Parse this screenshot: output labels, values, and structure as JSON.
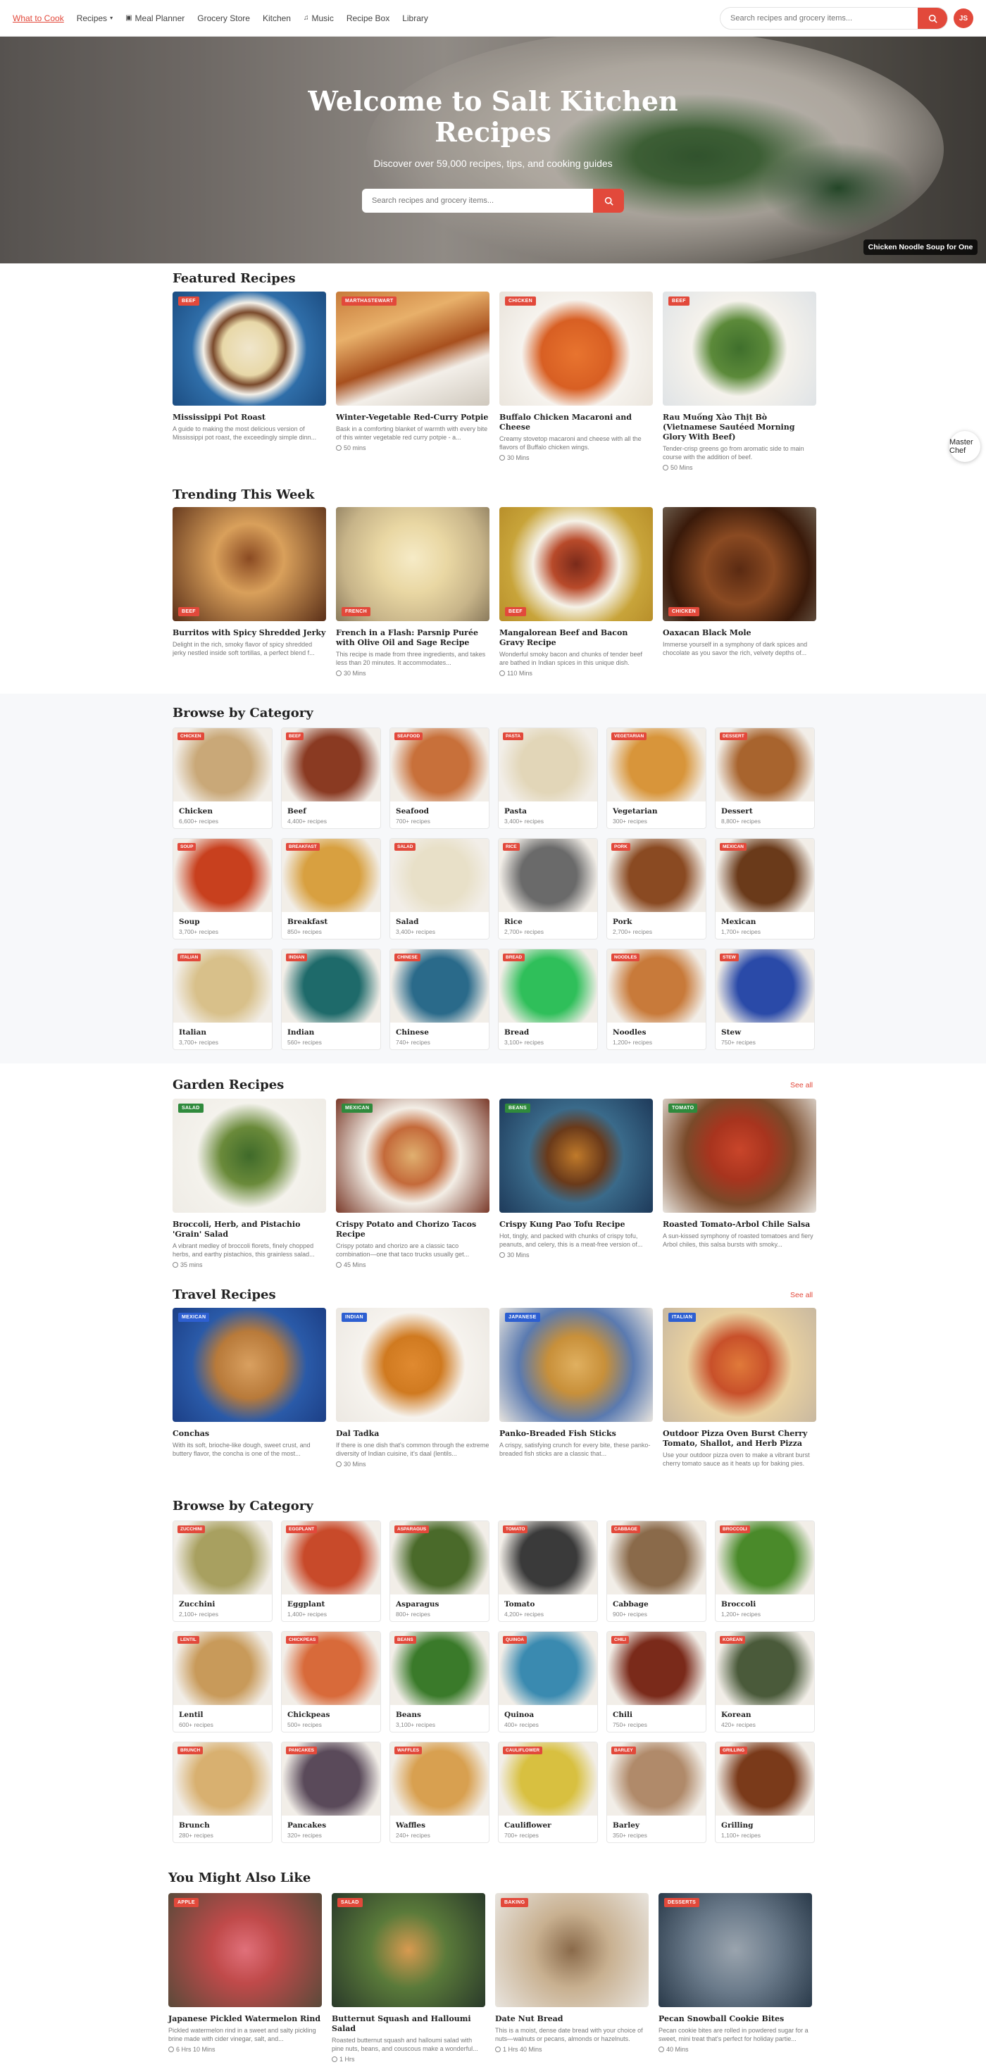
{
  "nav": {
    "links": [
      {
        "label": "What to Cook",
        "active": true
      },
      {
        "label": "Recipes",
        "dropdown": true
      },
      {
        "label": "Meal Planner",
        "icon": "calendar-icon"
      },
      {
        "label": "Grocery Store"
      },
      {
        "label": "Kitchen"
      },
      {
        "label": "Music",
        "icon": "music-note-icon"
      },
      {
        "label": "Recipe Box"
      },
      {
        "label": "Library"
      }
    ],
    "search_placeholder": "Search recipes and grocery items...",
    "avatar_initials": "JS"
  },
  "hero": {
    "title": "Welcome to Salt Kitchen Recipes",
    "subtitle": "Discover over 59,000 recipes, tips, and cooking guides",
    "search_placeholder": "Search recipes and grocery items...",
    "caption": "Chicken Noodle Soup for One"
  },
  "featured": {
    "title": "Featured Recipes",
    "items": [
      {
        "badge": "BEEF",
        "title": "Mississippi Pot Roast",
        "desc": "A guide to making the most delicious version of Mississippi pot roast, the exceedingly simple dinn...",
        "time": ""
      },
      {
        "badge": "MARTHASTEWART",
        "title": "Winter-Vegetable Red-Curry Potpie",
        "desc": "Bask in a comforting blanket of warmth with every bite of this winter vegetable red curry potpie - a...",
        "time": "50 mins"
      },
      {
        "badge": "CHICKEN",
        "title": "Buffalo Chicken Macaroni and Cheese",
        "desc": "Creamy stovetop macaroni and cheese with all the flavors of Buffalo chicken wings.",
        "time": "30 Mins"
      },
      {
        "badge": "BEEF",
        "title": "Rau Muống Xào Thịt Bò (Vietnamese Sautéed Morning Glory With Beef)",
        "desc": "Tender-crisp greens go from aromatic side to main course with the addition of beef.",
        "time": "50 Mins"
      }
    ]
  },
  "trending": {
    "title": "Trending This Week",
    "items": [
      {
        "badge": "BEEF",
        "title": "Burritos with Spicy Shredded Jerky",
        "desc": "Delight in the rich, smoky flavor of spicy shredded jerky nestled inside soft tortillas, a perfect blend f...",
        "time": ""
      },
      {
        "badge": "FRENCH",
        "title": "French in a Flash: Parsnip Purée with Olive Oil and Sage Recipe",
        "desc": "This recipe is made from three ingredients, and takes less than 20 minutes. It accommodates...",
        "time": "30 Mins"
      },
      {
        "badge": "BEEF",
        "title": "Mangalorean Beef and Bacon Gravy Recipe",
        "desc": "Wonderful smoky bacon and chunks of tender beef are bathed in Indian spices in this unique dish.",
        "time": "110 Mins"
      },
      {
        "badge": "CHICKEN",
        "title": "Oaxacan Black Mole",
        "desc": "Immerse yourself in a symphony of dark spices and chocolate as you savor the rich, velvety depths of...",
        "time": ""
      }
    ]
  },
  "browse1": {
    "title": "Browse by Category",
    "items": [
      {
        "name": "Chicken",
        "count": "6,600+ recipes"
      },
      {
        "name": "Beef",
        "count": "4,400+ recipes"
      },
      {
        "name": "Seafood",
        "count": "700+ recipes"
      },
      {
        "name": "Pasta",
        "count": "3,400+ recipes"
      },
      {
        "name": "Vegetarian",
        "count": "300+ recipes"
      },
      {
        "name": "Dessert",
        "count": "8,800+ recipes"
      },
      {
        "name": "Soup",
        "count": "3,700+ recipes"
      },
      {
        "name": "Breakfast",
        "count": "850+ recipes"
      },
      {
        "name": "Salad",
        "count": "3,400+ recipes"
      },
      {
        "name": "Rice",
        "count": "2,700+ recipes"
      },
      {
        "name": "Pork",
        "count": "2,700+ recipes"
      },
      {
        "name": "Mexican",
        "count": "1,700+ recipes"
      },
      {
        "name": "Italian",
        "count": "3,700+ recipes"
      },
      {
        "name": "Indian",
        "count": "560+ recipes"
      },
      {
        "name": "Chinese",
        "count": "740+ recipes"
      },
      {
        "name": "Bread",
        "count": "3,100+ recipes"
      },
      {
        "name": "Noodles",
        "count": "1,200+ recipes"
      },
      {
        "name": "Stew",
        "count": "750+ recipes"
      }
    ]
  },
  "garden": {
    "title": "Garden Recipes",
    "see_all": "See all",
    "items": [
      {
        "badge": "SALAD",
        "title": "Broccoli, Herb, and Pistachio 'Grain' Salad",
        "desc": "A vibrant medley of broccoli florets, finely chopped herbs, and earthy pistachios, this grainless salad...",
        "time": "35 mins"
      },
      {
        "badge": "MEXICAN",
        "title": "Crispy Potato and Chorizo Tacos Recipe",
        "desc": "Crispy potato and chorizo are a classic taco combination—one that taco trucks usually get...",
        "time": "45 Mins"
      },
      {
        "badge": "BEANS",
        "title": "Crispy Kung Pao Tofu Recipe",
        "desc": "Hot, tingly, and packed with chunks of crispy tofu, peanuts, and celery, this is a meat-free version of...",
        "time": "30 Mins"
      },
      {
        "badge": "TOMATO",
        "title": "Roasted Tomato-Arbol Chile Salsa",
        "desc": "A sun-kissed symphony of roasted tomatoes and fiery Arbol chiles, this salsa bursts with smoky...",
        "time": ""
      }
    ]
  },
  "travel": {
    "title": "Travel Recipes",
    "see_all": "See all",
    "items": [
      {
        "badge": "MEXICAN",
        "title": "Conchas",
        "desc": "With its soft, brioche-like dough, sweet crust, and buttery flavor, the concha is one of the most...",
        "time": ""
      },
      {
        "badge": "INDIAN",
        "title": "Dal Tadka",
        "desc": "If there is one dish that's common through the extreme diversity of Indian cuisine, it's daal (lentils...",
        "time": "30 Mins"
      },
      {
        "badge": "JAPANESE",
        "title": "Panko-Breaded Fish Sticks",
        "desc": "A crispy, satisfying crunch for every bite, these panko-breaded fish sticks are a classic that...",
        "time": ""
      },
      {
        "badge": "ITALIAN",
        "title": "Outdoor Pizza Oven Burst Cherry Tomato, Shallot, and Herb Pizza",
        "desc": "Use your outdoor pizza oven to make a vibrant burst cherry tomato sauce as it heats up for baking pies.",
        "time": ""
      }
    ]
  },
  "browse2": {
    "title": "Browse by Category",
    "items": [
      {
        "name": "Zucchini",
        "count": "2,100+ recipes"
      },
      {
        "name": "Eggplant",
        "count": "1,400+ recipes"
      },
      {
        "name": "Asparagus",
        "count": "800+ recipes"
      },
      {
        "name": "Tomato",
        "count": "4,200+ recipes"
      },
      {
        "name": "Cabbage",
        "count": "900+ recipes"
      },
      {
        "name": "Broccoli",
        "count": "1,200+ recipes"
      },
      {
        "name": "Lentil",
        "count": "600+ recipes"
      },
      {
        "name": "Chickpeas",
        "count": "500+ recipes"
      },
      {
        "name": "Beans",
        "count": "3,100+ recipes"
      },
      {
        "name": "Quinoa",
        "count": "400+ recipes"
      },
      {
        "name": "Chili",
        "count": "750+ recipes"
      },
      {
        "name": "Korean",
        "count": "420+ recipes"
      },
      {
        "name": "Brunch",
        "count": "280+ recipes"
      },
      {
        "name": "Pancakes",
        "count": "320+ recipes"
      },
      {
        "name": "Waffles",
        "count": "240+ recipes"
      },
      {
        "name": "Cauliflower",
        "count": "700+ recipes"
      },
      {
        "name": "Barley",
        "count": "350+ recipes"
      },
      {
        "name": "Grilling",
        "count": "1,100+ recipes"
      }
    ]
  },
  "also_like": {
    "title": "You Might Also Like",
    "items": [
      {
        "badge": "APPLE",
        "title": "Japanese Pickled Watermelon Rind",
        "desc": "Pickled watermelon rind in a sweet and salty pickling brine made with cider vinegar, salt, and...",
        "time": "6 Hrs 10 Mins"
      },
      {
        "badge": "SALAD",
        "title": "Butternut Squash and Halloumi Salad",
        "desc": "Roasted butternut squash and halloumi salad with pine nuts, beans, and couscous make a wonderful...",
        "time": "1 Hrs"
      },
      {
        "badge": "BAKING",
        "title": "Date Nut Bread",
        "desc": "This is a moist, dense date bread with your choice of nuts—walnuts or pecans, almonds or hazelnuts.",
        "time": "1 Hrs 40 Mins"
      },
      {
        "badge": "DESSERTS",
        "title": "Pecan Snowball Cookie Bites",
        "desc": "Pecan cookie bites are rolled in powdered sugar for a sweet, mini treat that's perfect for holiday partie...",
        "time": "40 Mins"
      }
    ]
  },
  "float_button": "Master Chef",
  "colors": {
    "accent": "#e2493b",
    "green_badge": "#2f8a3c",
    "blue_badge": "#2d5fd1"
  }
}
